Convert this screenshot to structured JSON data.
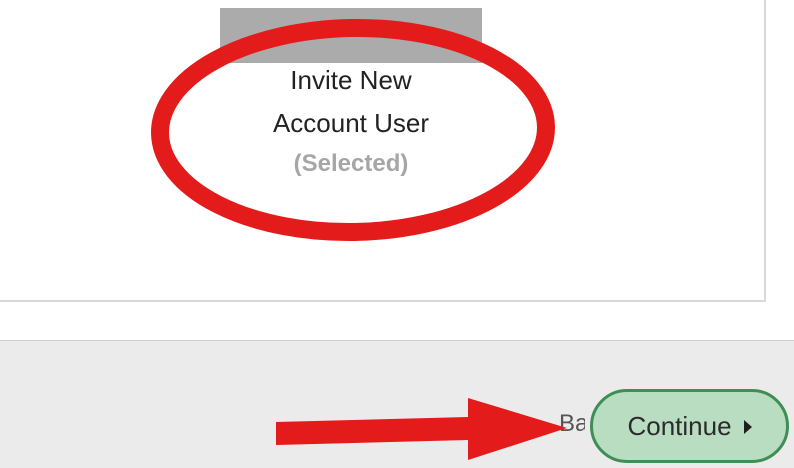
{
  "selection": {
    "option": {
      "title_line_1": "Invite New",
      "title_line_2": "Account User",
      "status": "(Selected)"
    }
  },
  "footer": {
    "back_label": "Back",
    "continue_label": "Continue",
    "continue_icon": "caret-right-icon"
  },
  "annotations": {
    "highlight_color": "#e31b1b",
    "highlight_shape": "ellipse-icon",
    "pointer_shape": "arrow-right-icon"
  },
  "colors": {
    "continue_fill": "#b8ddc1",
    "continue_border": "#3f8e54",
    "card_image": "#ababab",
    "footer_background": "#ebebeb"
  }
}
